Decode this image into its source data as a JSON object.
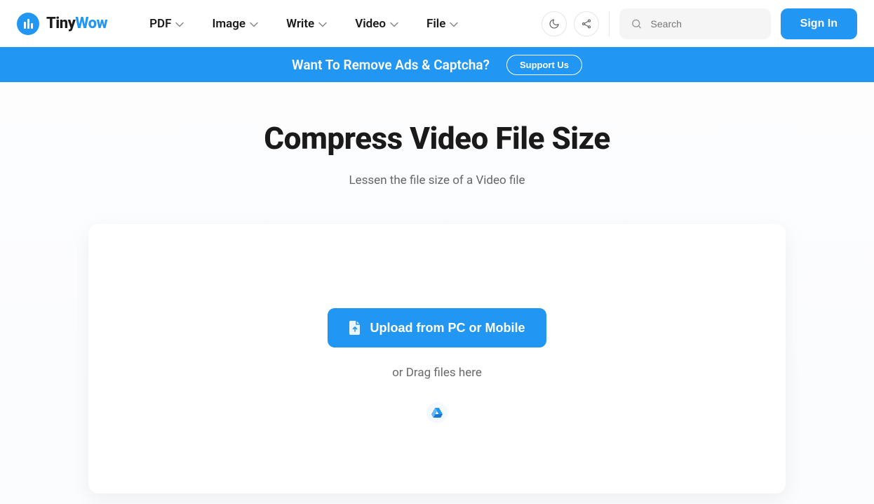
{
  "header": {
    "logo_tiny": "Tiny",
    "logo_wow": "Wow",
    "nav": [
      {
        "label": "PDF"
      },
      {
        "label": "Image"
      },
      {
        "label": "Write"
      },
      {
        "label": "Video"
      },
      {
        "label": "File"
      }
    ],
    "search_placeholder": "Search",
    "signin": "Sign In"
  },
  "promo": {
    "text": "Want To Remove Ads & Captcha?",
    "cta": "Support Us"
  },
  "main": {
    "title": "Compress Video File Size",
    "subtitle": "Lessen the file size of a Video file",
    "upload_label": "Upload from PC or Mobile",
    "drag_label": "or Drag files here"
  }
}
